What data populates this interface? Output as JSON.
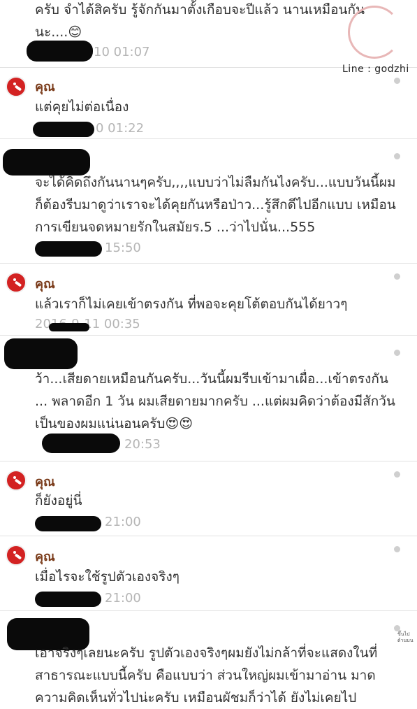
{
  "messages": [
    {
      "text": "ครับ จำได้สิครับ รู้จักกันมาตั้งเกือบจะปีแล้ว นานเหมือนกันนะ....😊",
      "time": "10 01:07"
    },
    {
      "name": "คุณ",
      "text": "แต่คุยไม่ต่อเนื่อง",
      "time": "0 01:22"
    },
    {
      "text": "จะได้คิดถึงกันนานๆครับ,,,,แบบว่าไม่ลืมกันไงครับ...แบบวันนี้ผมก็ต้องรีบมาดูว่าเราจะได้คุยกันหรือป่าว...รู้สึกดีไปอีกแบบ เหมือนการเขียนจดหมายรักในสมัยร.5 ...ว่าไปนั่น...555",
      "time": "15:50"
    },
    {
      "name": "คุณ",
      "text": "แล้วเราก็ไม่เคยเข้าตรงกัน ที่พอจะคุยโต้ตอบกันได้ยาวๆ",
      "time": "2016-9-11 00:35"
    },
    {
      "text": "ว้า...เสียดายเหมือนกันครับ...วันนี้ผมรีบเข้ามาเผื่อ...เข้าตรงกัน ... พลาดอีก 1 วัน ผมเสียดายมากครับ ...แต่ผมคิดว่าต้องมีสักวันเป็นของผมแน่นอนครับ😍😍",
      "time": "20:53"
    },
    {
      "name": "คุณ",
      "text": "ก็ยังอยู่นี่",
      "time": "21:00"
    },
    {
      "name": "คุณ",
      "text": "เมื่อไรจะใช้รูปตัวเองจริงๆ",
      "time": "21:00"
    },
    {
      "text": "เอาจริงๆเลยนะครับ รูปตัวเองจริงๆผมยังไม่กล้าที่จะแสดงในที่สาธารณะแบบนี้ครับ คือแบบว่า ส่วนใหญ่ผมเข้ามาอ่าน มาดความคิดเห็นทั่วไปน่ะครับ เหมือนผัชมก็ว่าได้ ยังไม่เคยไป"
    }
  ],
  "watermark": {
    "label": "Line : godzhi"
  },
  "side_note": "ขึ้นไป ด้านบน",
  "colors": {
    "avatar": "#d32222",
    "name": "#7a3b1a",
    "time": "#b5b5b5"
  }
}
